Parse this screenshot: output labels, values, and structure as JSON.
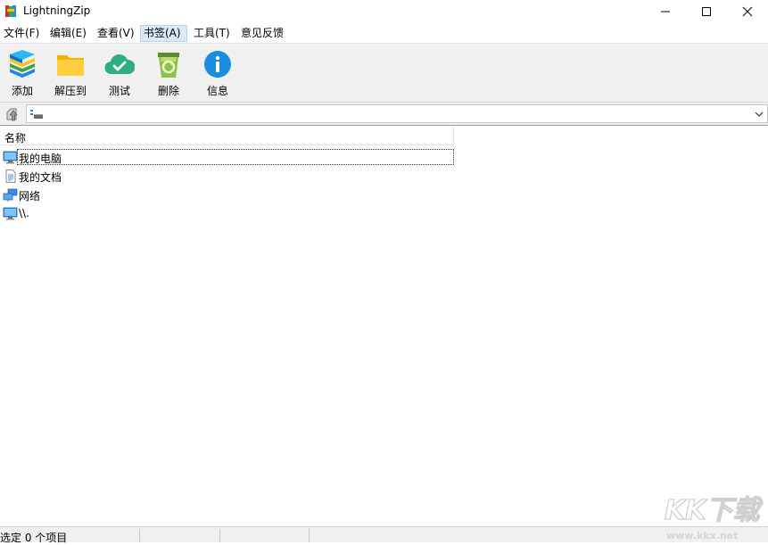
{
  "window": {
    "title": "LightningZip",
    "icon": "rar-books-icon"
  },
  "menu": [
    {
      "label": "文件(F)"
    },
    {
      "label": "编辑(E)"
    },
    {
      "label": "查看(V)"
    },
    {
      "label": "书签(A)",
      "active": true
    },
    {
      "label": "工具(T)"
    },
    {
      "label": "意见反馈"
    }
  ],
  "toolbar": [
    {
      "label": "添加",
      "icon": "add-books-icon"
    },
    {
      "label": "解压到",
      "icon": "folder-icon"
    },
    {
      "label": "测试",
      "icon": "cloud-check-icon"
    },
    {
      "label": "删除",
      "icon": "recycle-bin-icon"
    },
    {
      "label": "信息",
      "icon": "info-icon"
    }
  ],
  "address": {
    "value": "",
    "drive_icon": "drive-icon"
  },
  "list": {
    "column_name": "名称",
    "items": [
      {
        "label": "我的电脑",
        "icon": "computer-icon",
        "focused": true
      },
      {
        "label": "我的文档",
        "icon": "document-icon"
      },
      {
        "label": "网络",
        "icon": "network-icon"
      },
      {
        "label": "\\\\.",
        "icon": "computer-icon"
      }
    ]
  },
  "status": {
    "text": "选定 0 个项目"
  },
  "watermark": {
    "text": "KK下载",
    "url": "www.kkx.net"
  },
  "colors": {
    "menu_active_bg": "#dbeaf7",
    "toolbar_bg": "#f0f0f0",
    "info_blue": "#1a8ce0",
    "cloud_green": "#2fae86"
  }
}
